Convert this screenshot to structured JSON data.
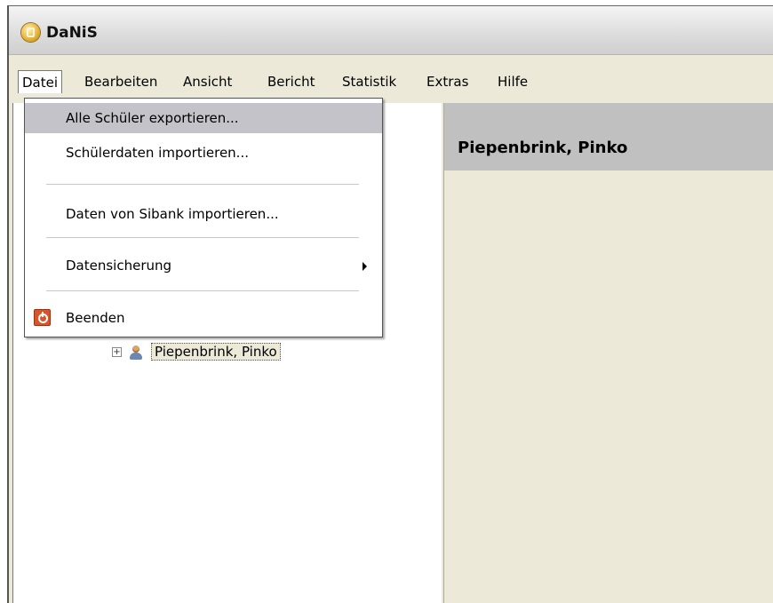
{
  "window": {
    "title": "DaNiS"
  },
  "menubar": {
    "items": [
      "Datei",
      "Bearbeiten",
      "Ansicht",
      "Bericht",
      "Statistik",
      "Extras",
      "Hilfe"
    ],
    "active": "Datei"
  },
  "file_menu": {
    "items": [
      {
        "label": "Alle Schüler exportieren..."
      },
      {
        "label": "Schülerdaten importieren..."
      },
      {
        "label": "Daten von Sibank importieren..."
      },
      {
        "label": "Datensicherung",
        "icon": "submenu-arrow-icon"
      },
      {
        "label": "Beenden",
        "icon": "power-icon"
      }
    ]
  },
  "tree": {
    "selected_node": {
      "label": "Piepenbrink, Pinko",
      "icon": "person-icon"
    }
  },
  "detail": {
    "header": "Piepenbrink, Pinko"
  },
  "colors": {
    "highlight": "#c3c3c9",
    "panel_header": "#c0c0c0",
    "menubar_bg": "#ece9d8"
  }
}
